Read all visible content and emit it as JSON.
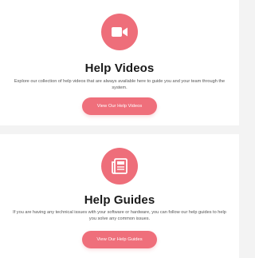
{
  "sections": [
    {
      "icon": "video-camera-icon",
      "title": "Help Videos",
      "description": "Explore our collection of help videos that are always available here to guide you and your team through the system.",
      "button_label": "View Our Help Videos"
    },
    {
      "icon": "newspaper-icon",
      "title": "Help Guides",
      "description": "If you are having any technical issues with your software or hardware, you can follow our help guides to help you solve any common issues.",
      "button_label": "View Our Help Guides"
    }
  ],
  "colors": {
    "accent": "#ee6e7a",
    "background": "#f3f3f3",
    "card": "#ffffff",
    "title": "#1a1a1a",
    "body_text": "#555555"
  }
}
